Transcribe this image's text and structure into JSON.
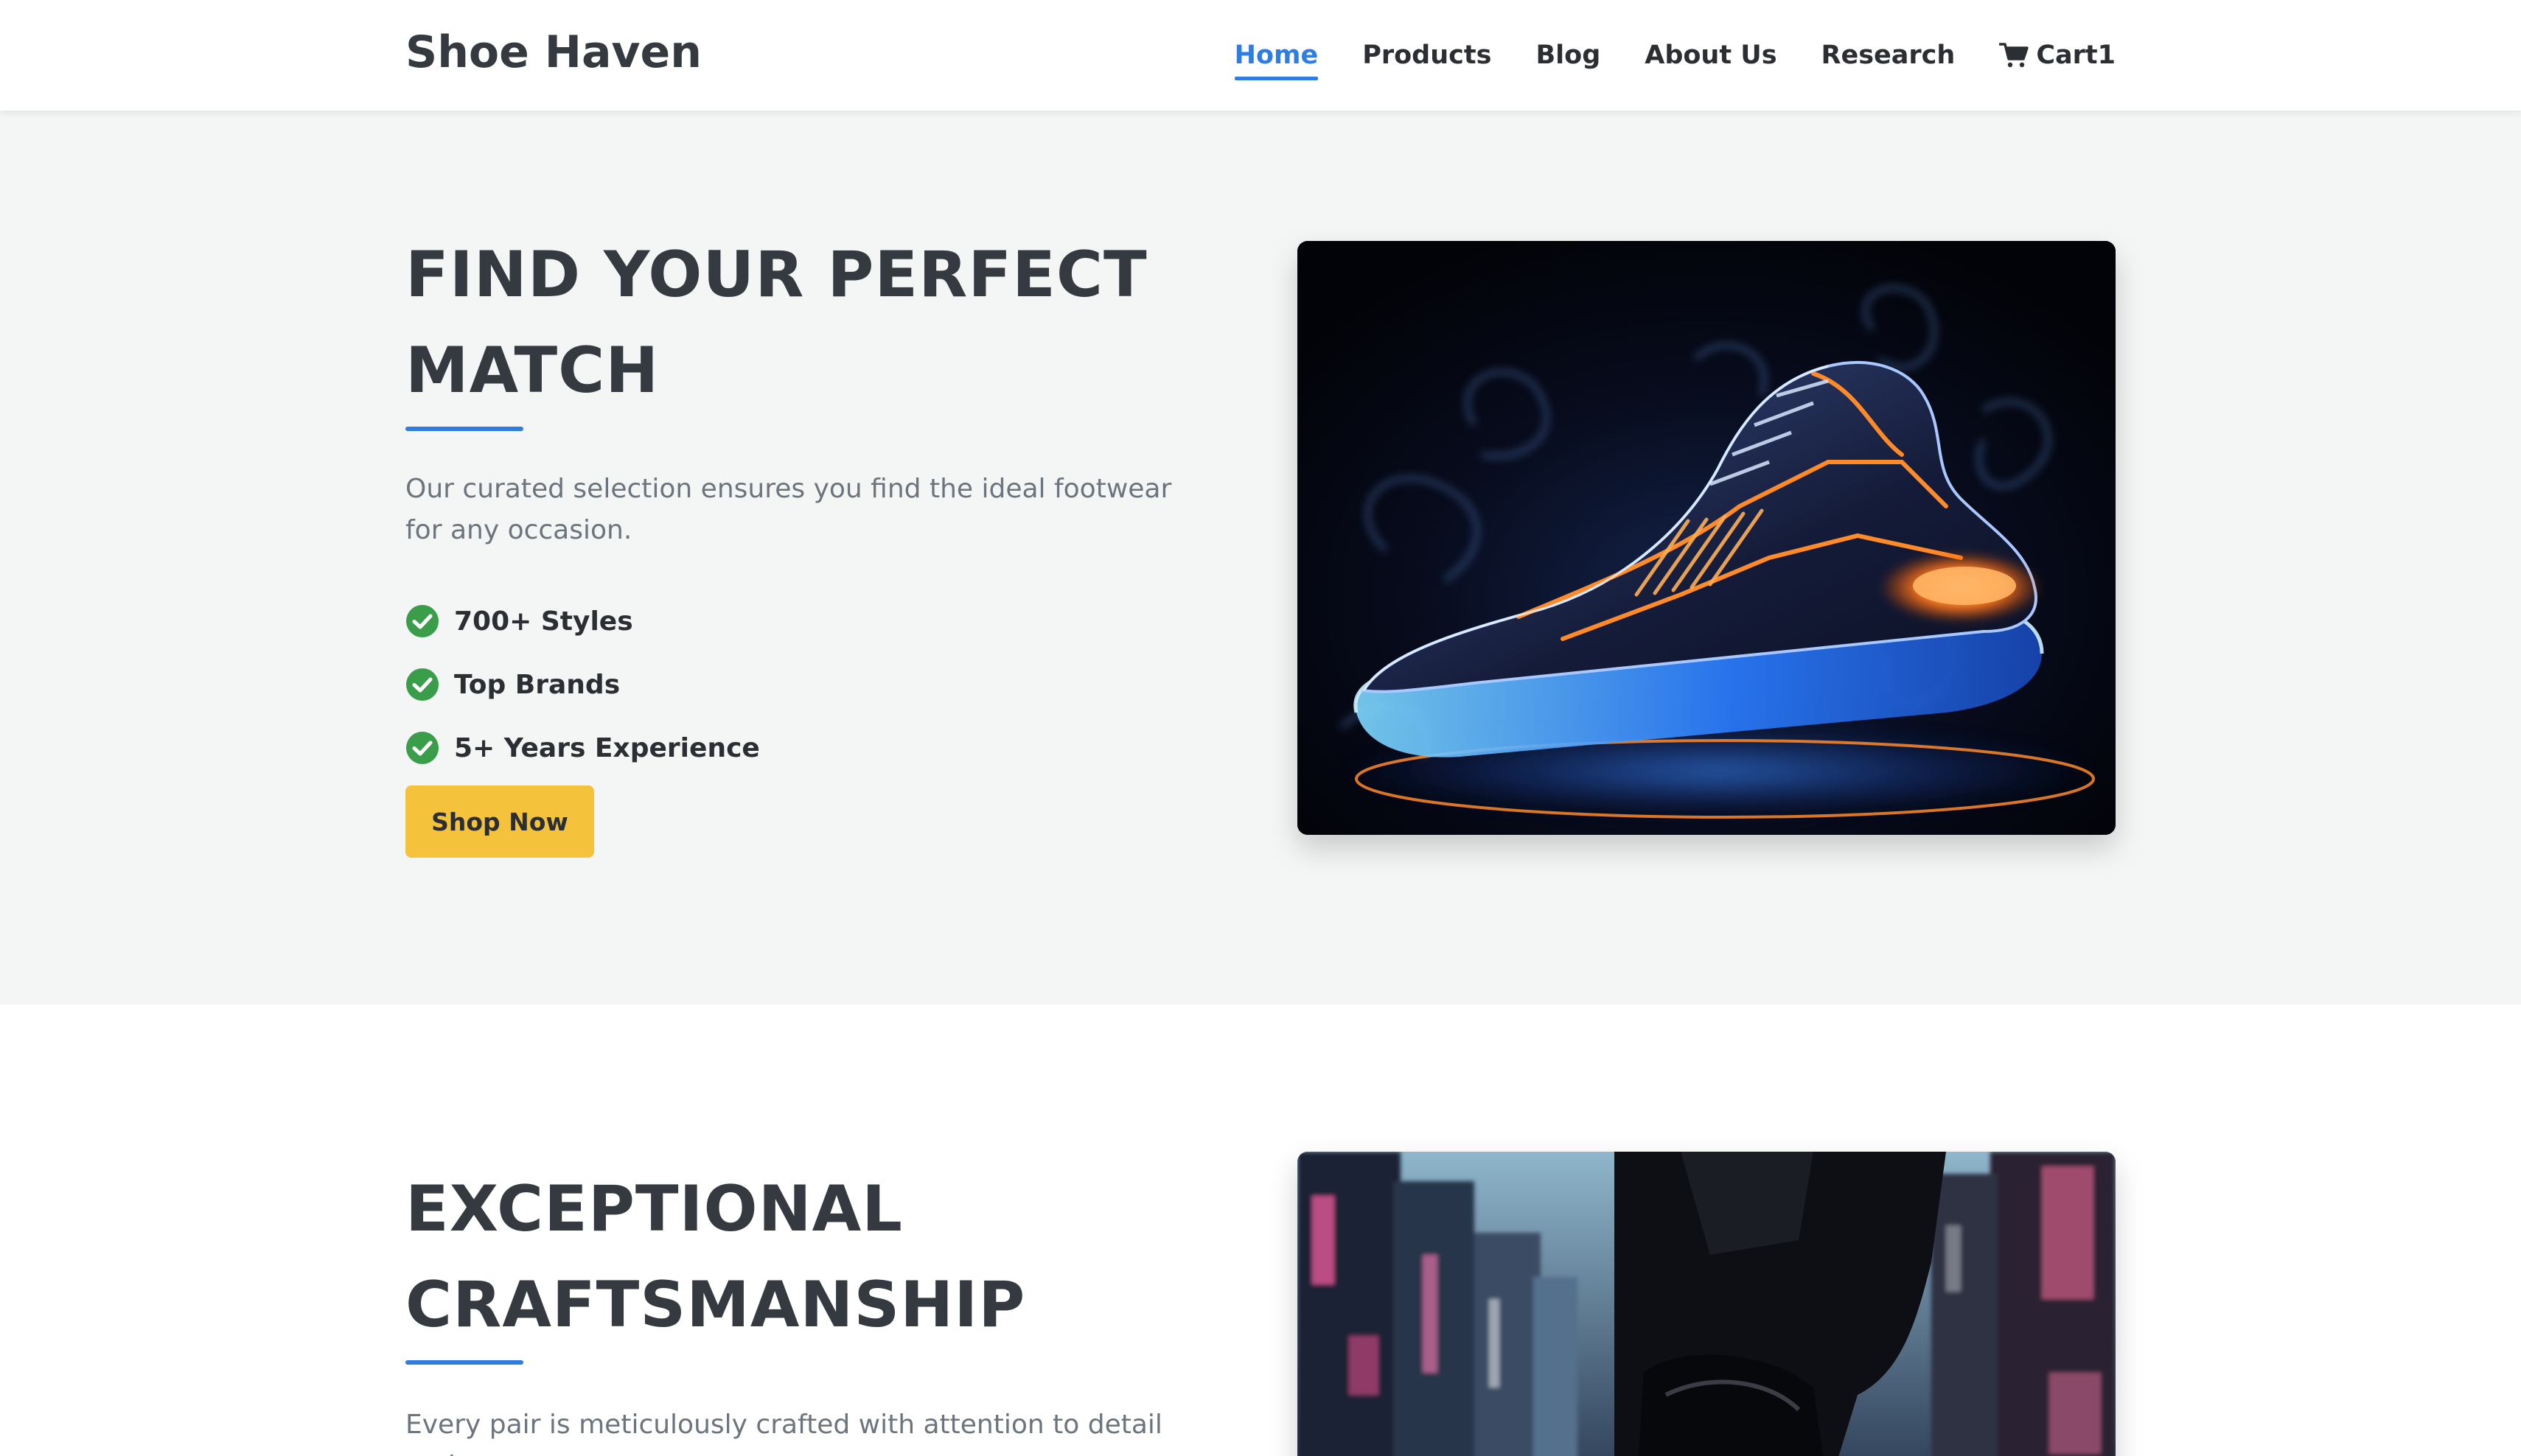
{
  "navbar": {
    "brand": "Shoe Haven",
    "links": [
      {
        "label": "Home",
        "active": true
      },
      {
        "label": "Products"
      },
      {
        "label": "Blog"
      },
      {
        "label": "About Us"
      },
      {
        "label": "Research"
      }
    ],
    "cart": {
      "label": "Cart",
      "count": "1",
      "icon": "cart-icon"
    }
  },
  "hero": {
    "title_line1": "FIND YOUR PERFECT",
    "title_line2": "MATCH",
    "description": "Our curated selection ensures you find the ideal footwear for any occasion.",
    "features": [
      {
        "label": "700+ Styles",
        "icon": "check-circle-icon"
      },
      {
        "label": "Top Brands",
        "icon": "check-circle-icon"
      },
      {
        "label": "5+ Years Experience",
        "icon": "check-circle-icon"
      }
    ],
    "cta_label": "Shop Now",
    "image": "glowing-sneaker-image"
  },
  "craftsmanship": {
    "title_line1": "EXCEPTIONAL",
    "title_line2": "CRAFTSMANSHIP",
    "description": "Every pair is meticulously crafted with attention to detail and",
    "image": "neon-city-shoe-image"
  },
  "colors": {
    "accent": "#2f7de1",
    "button": "#f5c33b",
    "check": "#3a9d4a",
    "hero_bg": "#f4f6f5"
  }
}
